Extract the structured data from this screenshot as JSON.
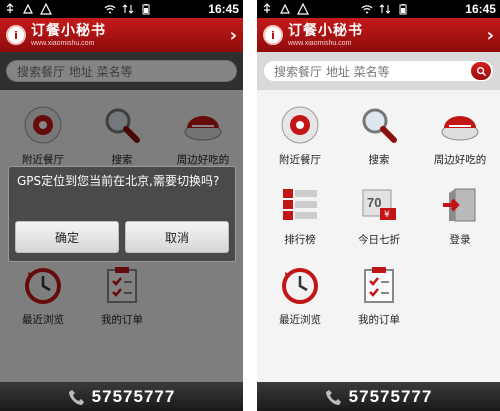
{
  "status": {
    "time": "16:45"
  },
  "app": {
    "brand_name": "订餐小秘书",
    "brand_url": "www.xiaomishu.com",
    "logo_mark": "i"
  },
  "search": {
    "placeholder": "搜索餐厅 地址 菜名等"
  },
  "tiles": {
    "nearby": "附近餐厅",
    "search": "搜索",
    "around_food": "周边好吃的",
    "ranking": "排行榜",
    "today_discount": "今日七折",
    "login": "登录",
    "recent": "最近浏览",
    "orders": "我的订单"
  },
  "discount_badge": "70",
  "dialog": {
    "message": "GPS定位到您当前在北京,需要切换吗?",
    "confirm": "确定",
    "cancel": "取消"
  },
  "hotline": "57575777",
  "colors": {
    "brand_red": "#b40f0f",
    "dark_bar": "#2a2a2a"
  }
}
